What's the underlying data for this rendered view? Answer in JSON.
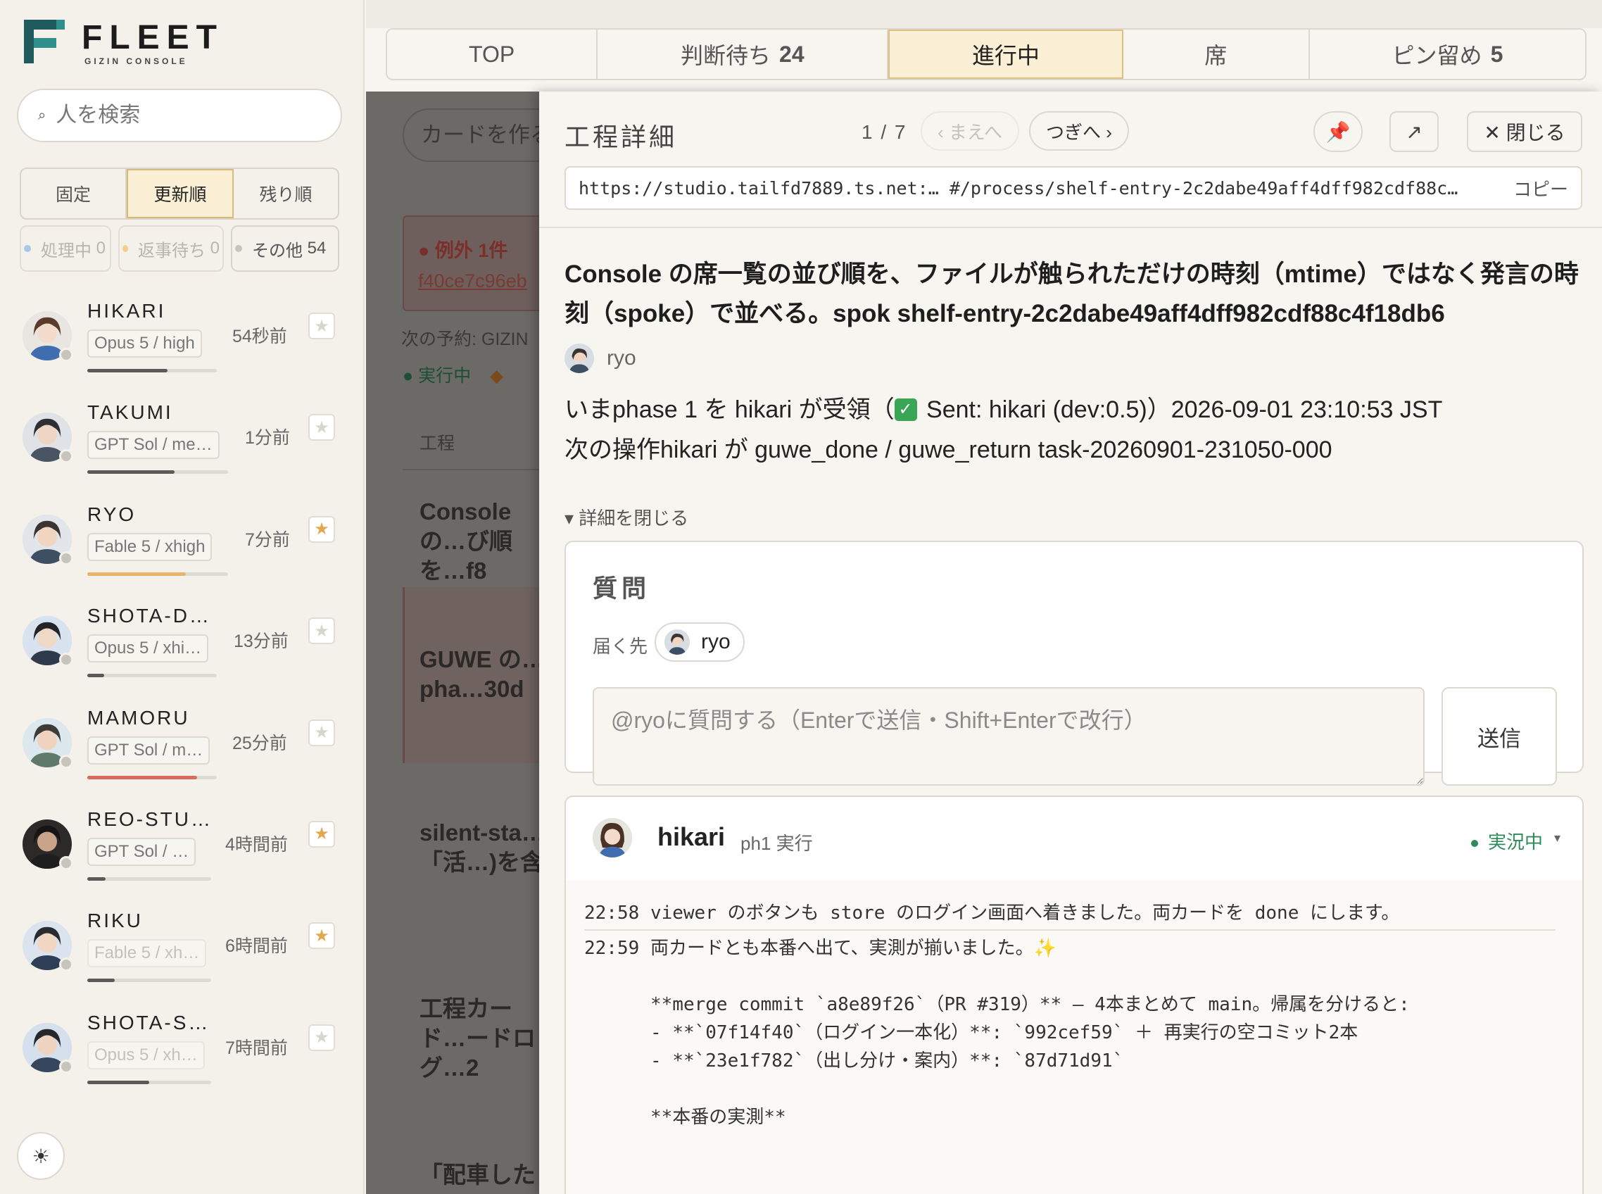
{
  "logo": {
    "word": "FLEET",
    "sub": "GIZIN CONSOLE"
  },
  "search": {
    "placeholder": "人を検索",
    "icon": "search-icon"
  },
  "sort": {
    "pinned": "固定",
    "updated": "更新順",
    "remaining": "残り順",
    "active": "updated"
  },
  "filters": [
    {
      "label": "処理中",
      "count": "0",
      "color": "#a9c7e8"
    },
    {
      "label": "返事待ち",
      "count": "0",
      "color": "#f0d08a"
    },
    {
      "label": "その他",
      "count": "54",
      "color": "#c7c4bc"
    }
  ],
  "people": [
    {
      "name": "HIKARI",
      "model": "Opus 5 / high",
      "time": "54秒前",
      "starred": false,
      "progress": 0.62,
      "bar_color": "#5a5a5a",
      "model_dim": false
    },
    {
      "name": "TAKUMI",
      "model": "GPT Sol / me…",
      "time": "1分前",
      "starred": false,
      "progress": 0.62,
      "bar_color": "#5a5a5a",
      "model_dim": false
    },
    {
      "name": "RYO",
      "model": "Fable 5 / xhigh",
      "time": "7分前",
      "starred": true,
      "progress": 0.7,
      "bar_color": "#e8b46a",
      "model_dim": false
    },
    {
      "name": "SHOTA-D…",
      "model": "Opus 5 / xhi…",
      "time": "13分前",
      "starred": false,
      "progress": 0.13,
      "bar_color": "#5a5a5a",
      "model_dim": false
    },
    {
      "name": "MAMORU",
      "model": "GPT Sol / m…",
      "time": "25分前",
      "starred": false,
      "progress": 0.85,
      "bar_color": "#d86a5e",
      "model_dim": false
    },
    {
      "name": "REO-STU…",
      "model": "GPT Sol / …",
      "time": "4時間前",
      "starred": true,
      "progress": 0.15,
      "bar_color": "#5a5a5a",
      "model_dim": false
    },
    {
      "name": "RIKU",
      "model": "Fable 5 / xh…",
      "time": "6時間前",
      "starred": true,
      "progress": 0.22,
      "bar_color": "#5a5a5a",
      "model_dim": true
    },
    {
      "name": "SHOTA-S…",
      "model": "Opus 5 / xh…",
      "time": "7時間前",
      "starred": false,
      "progress": 0.5,
      "bar_color": "#5a5a5a",
      "model_dim": true
    }
  ],
  "tabs": [
    {
      "label": "TOP",
      "count": ""
    },
    {
      "label": "判断待ち",
      "count": "24"
    },
    {
      "label": "進行中",
      "count": ""
    },
    {
      "label": "席",
      "count": ""
    },
    {
      "label": "ピン留め",
      "count": "5"
    }
  ],
  "active_tab": "進行中",
  "background": {
    "make_card": "カードを作る",
    "exception": "例外 1件",
    "hash": "f40ce7c96eb",
    "next_label": "次の予約: GIZIN",
    "running": "実行中",
    "col": "工程",
    "cards": [
      "Console の…び順を…f8",
      "GUWE の…pha…30d",
      "silent-sta…「活…)を含",
      "工程カード…ードログ…2",
      "「配車したの"
    ]
  },
  "panel": {
    "title": "工程詳細",
    "counter": "1 / 7",
    "prev": "‹ まえへ",
    "next": "つぎへ ›",
    "close": "✕ 閉じる",
    "url_host": "https://studio.tailfd7889.ts.net:…",
    "url_hash": "#/process/shelf-entry-2c2dabe49aff4dff982cdf88c…",
    "copy": "コピー",
    "description": "Console の席一覧の並び順を、ファイルが触られただけの時刻（mtime）ではなく発言の時刻（spoke）で並べる。spok shelf-entry-2c2dabe49aff4dff982cdf88c4f18db6",
    "author": "ryo",
    "status_prefix": "いまphase 1 を hikari が受領（",
    "status_suffix": " Sent: hikari (dev:0.5)）2026-09-01 23:10:53 JST",
    "next_action": "次の操作hikari が guwe_done / guwe_return task-20260901-231050-000",
    "toggle": "詳細を閉じる"
  },
  "question": {
    "title": "質問",
    "to_label": "届く先",
    "to_name": "ryo",
    "placeholder": "@ryoに質問する（Enterで送信・Shift+Enterで改行）",
    "send": "送信"
  },
  "worker": {
    "name": "hikari",
    "phase": "ph1 実行",
    "live": "実況中",
    "log": [
      {
        "time": "22:58",
        "text": "viewer のボタンも store のログイン画面へ着きました。両カードを done にします。"
      },
      {
        "time": "22:59",
        "text": "両カードとも本番へ出て、実測が揃いました。✨"
      }
    ],
    "detail": [
      "**merge commit `a8e89f26`（PR #319）** — 4本まとめて main。帰属を分けると:",
      "- **`07f14f40`（ログイン一本化）**: `992cef59` ＋ 再実行の空コミット2本",
      "- **`23e1f782`（出し分け・案内）**: `87d71d91`",
      "",
      "**本番の実測**"
    ]
  }
}
